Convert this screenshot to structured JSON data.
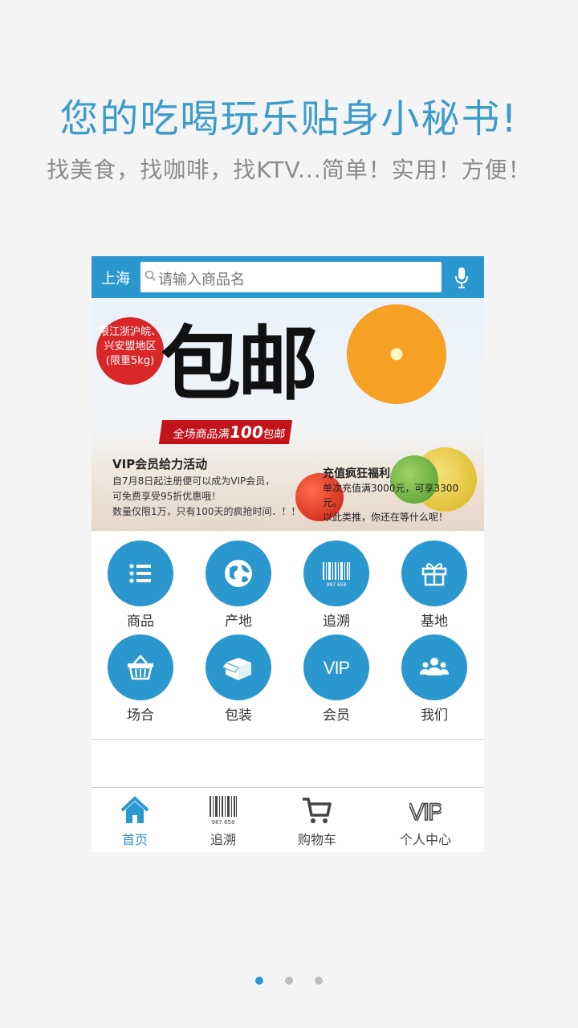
{
  "headline": "您的吃喝玩乐贴身小秘书!",
  "subline": "找美食，找咖啡，找KTV...简单！实用！方便！",
  "app": {
    "city": "上海",
    "search_placeholder": "请输入商品名",
    "banner": {
      "ribbon": [
        "限江浙沪皖、",
        "兴安盟地区",
        "(限重5kg)"
      ],
      "big_title": "包邮",
      "strip_prefix": "全场商品满",
      "strip_number": "100",
      "strip_suffix": "包邮",
      "vip_title": "VIP会员给力活动",
      "vip_lines": [
        "自7月8日起注册便可以成为VIP会员，",
        "可免费享受95折优惠哦！",
        "数量仅限1万，只有100天的疯抢时间．！！"
      ],
      "promo_title": "充值疯狂福利",
      "promo_lines": [
        "单次充值满3000元，可享3300元。",
        "以此类推，你还在等什么呢！"
      ]
    },
    "grid": [
      {
        "label": "商品",
        "icon": "list-icon"
      },
      {
        "label": "产地",
        "icon": "globe-icon"
      },
      {
        "label": "追溯",
        "icon": "barcode-icon"
      },
      {
        "label": "基地",
        "icon": "gift-icon"
      },
      {
        "label": "场合",
        "icon": "basket-icon"
      },
      {
        "label": "包装",
        "icon": "box-icon"
      },
      {
        "label": "会员",
        "icon": "vip-icon"
      },
      {
        "label": "我们",
        "icon": "users-icon"
      }
    ],
    "tabs": [
      {
        "label": "首页",
        "icon": "home-icon",
        "active": true
      },
      {
        "label": "追溯",
        "icon": "barcode-icon"
      },
      {
        "label": "购物车",
        "icon": "cart-icon"
      },
      {
        "label": "个人中心",
        "icon": "vip-icon"
      }
    ],
    "barcode_number": "987 658",
    "vip_text": "VIP"
  },
  "pager": {
    "count": 3,
    "active_index": 0
  },
  "colors": {
    "accent": "#2b97cf",
    "headline": "#3d9ccb",
    "promo_red": "#c4141b"
  }
}
